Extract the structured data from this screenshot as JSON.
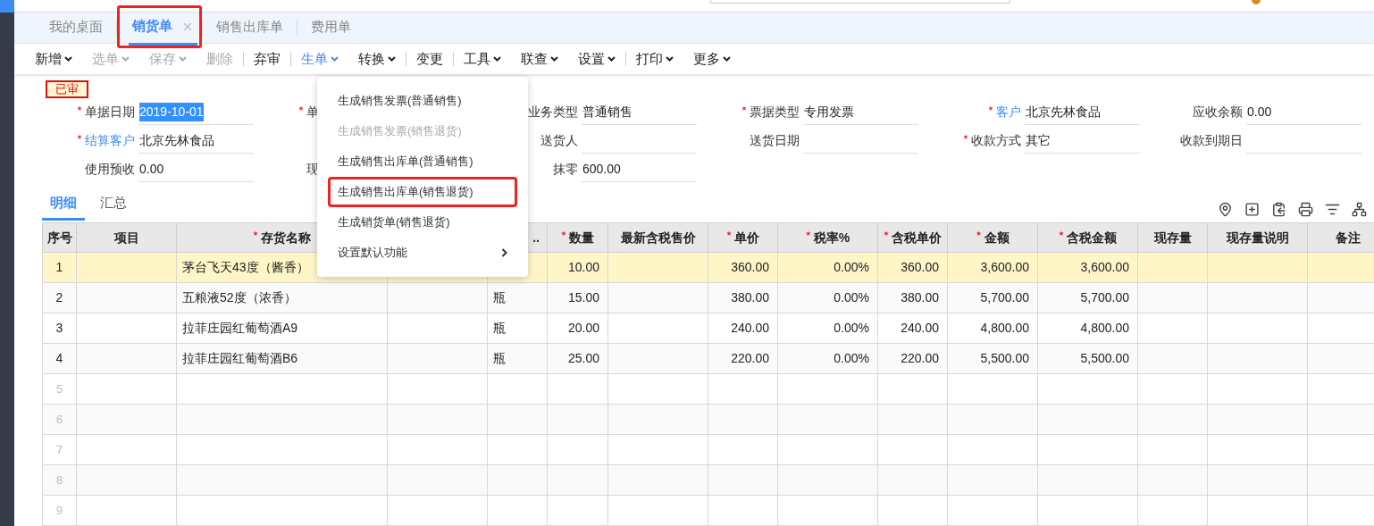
{
  "tabs": [
    {
      "label": "我的桌面",
      "selected": false,
      "closable": false,
      "highlighted": false
    },
    {
      "label": "销货单",
      "selected": true,
      "closable": true,
      "highlighted": true
    },
    {
      "label": "销售出库单",
      "selected": false,
      "closable": false,
      "highlighted": false
    },
    {
      "label": "费用单",
      "selected": false,
      "closable": false,
      "highlighted": false
    }
  ],
  "toolbar": [
    {
      "label": "新增",
      "caret": true,
      "disabled": false,
      "open": false,
      "separator_before": false
    },
    {
      "label": "选单",
      "caret": true,
      "disabled": true,
      "open": false,
      "separator_before": false
    },
    {
      "label": "保存",
      "caret": true,
      "disabled": true,
      "open": false,
      "separator_before": false
    },
    {
      "label": "删除",
      "caret": false,
      "disabled": true,
      "open": false,
      "separator_before": false
    },
    {
      "label": "弃审",
      "caret": false,
      "disabled": false,
      "open": false,
      "separator_before": true
    },
    {
      "label": "生单",
      "caret": true,
      "disabled": false,
      "open": true,
      "separator_before": true
    },
    {
      "label": "转换",
      "caret": true,
      "disabled": false,
      "open": false,
      "separator_before": false
    },
    {
      "label": "变更",
      "caret": false,
      "disabled": false,
      "open": false,
      "separator_before": true
    },
    {
      "label": "工具",
      "caret": true,
      "disabled": false,
      "open": false,
      "separator_before": true
    },
    {
      "label": "联查",
      "caret": true,
      "disabled": false,
      "open": false,
      "separator_before": false
    },
    {
      "label": "设置",
      "caret": true,
      "disabled": false,
      "open": false,
      "separator_before": false
    },
    {
      "label": "打印",
      "caret": true,
      "disabled": false,
      "open": false,
      "separator_before": true
    },
    {
      "label": "更多",
      "caret": true,
      "disabled": false,
      "open": false,
      "separator_before": false
    }
  ],
  "dropdown": [
    {
      "label": "生成销售发票(普通销售)",
      "disabled": false,
      "submenu": false,
      "highlighted": false
    },
    {
      "label": "生成销售发票(销售退货)",
      "disabled": true,
      "submenu": false,
      "highlighted": false
    },
    {
      "label": "生成销售出库单(普通销售)",
      "disabled": false,
      "submenu": false,
      "highlighted": false
    },
    {
      "label": "生成销售出库单(销售退货)",
      "disabled": false,
      "submenu": false,
      "highlighted": true
    },
    {
      "label": "生成销货单(销售退货)",
      "disabled": false,
      "submenu": false,
      "highlighted": false
    },
    {
      "label": "设置默认功能",
      "disabled": false,
      "submenu": true,
      "highlighted": false
    }
  ],
  "status_badge": "已审",
  "form_rows": [
    [
      {
        "kind": "field",
        "label": "单据日期",
        "required": true,
        "link": false,
        "value": "2019-10-01",
        "value_selected": true
      },
      {
        "kind": "covered",
        "label": "单",
        "required": true,
        "link": false
      },
      {
        "kind": "field",
        "label": "业务类型",
        "required": false,
        "link": false,
        "value": "普通销售",
        "value_selected": false
      },
      {
        "kind": "field",
        "label": "票据类型",
        "required": true,
        "link": false,
        "value": "专用发票",
        "value_selected": false
      },
      {
        "kind": "field",
        "label": "客户",
        "required": true,
        "link": true,
        "value": "北京先林食品",
        "value_selected": false
      },
      {
        "kind": "field",
        "label": "应收余额",
        "required": false,
        "link": false,
        "value": "0.00",
        "value_selected": false
      }
    ],
    [
      {
        "kind": "field",
        "label": "结算客户",
        "required": true,
        "link": true,
        "value": "北京先林食品",
        "value_selected": false
      },
      {
        "kind": "covered"
      },
      {
        "kind": "field",
        "label": "送货人",
        "required": false,
        "link": false
      },
      {
        "kind": "field",
        "label": "送货日期",
        "required": false,
        "link": false
      },
      {
        "kind": "field",
        "label": "收款方式",
        "required": true,
        "link": false,
        "value": "其它",
        "value_selected": false
      },
      {
        "kind": "field",
        "label": "收款到期日",
        "required": false,
        "link": false
      }
    ],
    [
      {
        "kind": "field",
        "label": "使用预收",
        "required": false,
        "link": false,
        "value": "0.00",
        "value_selected": false
      },
      {
        "kind": "covered",
        "label": "现",
        "required": false,
        "link": false
      },
      {
        "kind": "field",
        "label": "抹零",
        "required": false,
        "link": false,
        "value": "600.00",
        "value_selected": false
      }
    ]
  ],
  "detail_tabs": [
    {
      "label": "明细",
      "selected": true
    },
    {
      "label": "汇总",
      "selected": false
    }
  ],
  "table": {
    "columns": [
      {
        "label": "序号",
        "required": false
      },
      {
        "label": "项目",
        "required": false
      },
      {
        "label": "存货名称",
        "required": true
      },
      {},
      {
        "label": "..",
        "required": false
      },
      {
        "label": "数量",
        "required": true
      },
      {
        "label": "最新含税售价",
        "required": false
      },
      {
        "label": "单价",
        "required": true
      },
      {
        "label": "税率%",
        "required": true
      },
      {
        "label": "含税单价",
        "required": true
      },
      {
        "label": "金额",
        "required": true
      },
      {
        "label": "含税金额",
        "required": true
      },
      {
        "label": "现存量",
        "required": false
      },
      {
        "label": "现存量说明",
        "required": false
      },
      {
        "label": "备注",
        "required": false
      }
    ],
    "rows": [
      {
        "selected": true,
        "empty": false,
        "cells": [
          "1",
          null,
          "茅台飞天43度（酱香）",
          null,
          null,
          "10.00",
          null,
          "360.00",
          "0.00%",
          "360.00",
          "3,600.00",
          "3,600.00",
          null,
          null,
          null
        ]
      },
      {
        "selected": false,
        "empty": false,
        "cells": [
          "2",
          null,
          "五粮液52度（浓香）",
          null,
          "瓶",
          "15.00",
          null,
          "380.00",
          "0.00%",
          "380.00",
          "5,700.00",
          "5,700.00",
          null,
          null,
          null
        ]
      },
      {
        "selected": false,
        "empty": false,
        "cells": [
          "3",
          null,
          "拉菲庄园红葡萄酒A9",
          null,
          "瓶",
          "20.00",
          null,
          "240.00",
          "0.00%",
          "240.00",
          "4,800.00",
          "4,800.00",
          null,
          null,
          null
        ]
      },
      {
        "selected": false,
        "empty": false,
        "cells": [
          "4",
          null,
          "拉菲庄园红葡萄酒B6",
          null,
          "瓶",
          "25.00",
          null,
          "220.00",
          "0.00%",
          "220.00",
          "5,500.00",
          "5,500.00",
          null,
          null,
          null
        ]
      },
      {
        "selected": false,
        "empty": true,
        "cells": [
          "5"
        ]
      },
      {
        "selected": false,
        "empty": true,
        "cells": [
          "6"
        ]
      },
      {
        "selected": false,
        "empty": true,
        "cells": [
          "7"
        ]
      },
      {
        "selected": false,
        "empty": true,
        "cells": [
          "8"
        ]
      },
      {
        "selected": false,
        "empty": true,
        "cells": [
          "9"
        ]
      }
    ]
  }
}
